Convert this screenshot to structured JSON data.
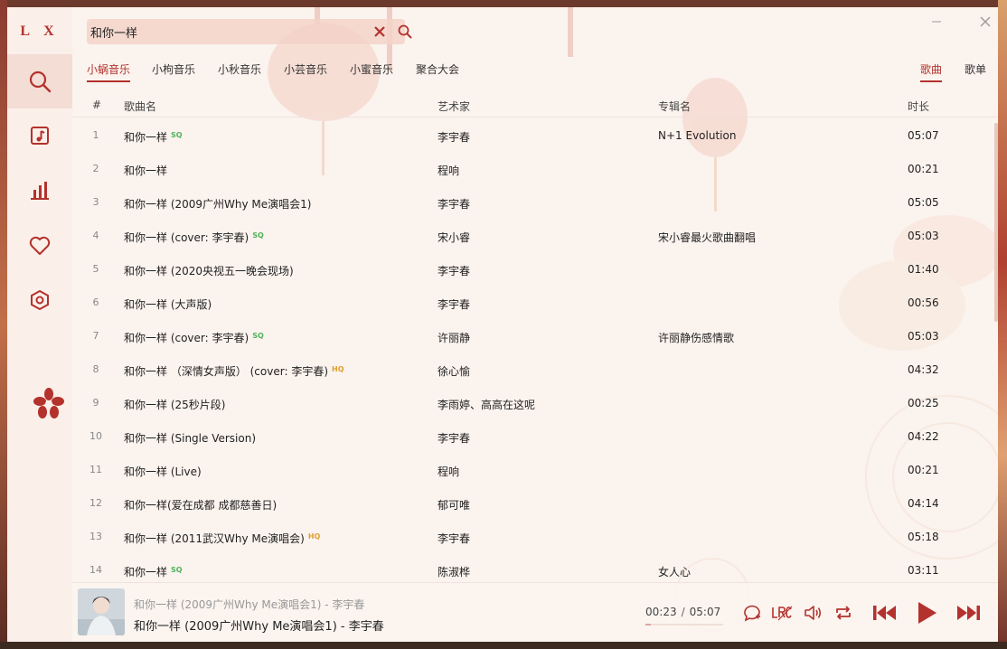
{
  "app": {
    "logo": "L X"
  },
  "search": {
    "value": "和你一样"
  },
  "source_tabs": [
    {
      "label": "小蜗音乐",
      "active": true
    },
    {
      "label": "小枸音乐",
      "active": false
    },
    {
      "label": "小秋音乐",
      "active": false
    },
    {
      "label": "小芸音乐",
      "active": false
    },
    {
      "label": "小蜜音乐",
      "active": false
    },
    {
      "label": "聚合大会",
      "active": false
    }
  ],
  "type_tabs": [
    {
      "label": "歌曲",
      "active": true
    },
    {
      "label": "歌单",
      "active": false
    }
  ],
  "table": {
    "headers": {
      "num": "#",
      "name": "歌曲名",
      "artist": "艺术家",
      "album": "专辑名",
      "duration": "时长"
    },
    "rows": [
      {
        "num": "1",
        "name": "和你一样",
        "quality": "SQ",
        "artist": "李宇春",
        "album": "N+1 Evolution",
        "duration": "05:07"
      },
      {
        "num": "2",
        "name": "和你一样",
        "quality": "",
        "artist": "程响",
        "album": "",
        "duration": "00:21"
      },
      {
        "num": "3",
        "name": "和你一样 (2009广州Why Me演唱会1)",
        "quality": "",
        "artist": "李宇春",
        "album": "",
        "duration": "05:05"
      },
      {
        "num": "4",
        "name": "和你一样 (cover: 李宇春)",
        "quality": "SQ",
        "artist": "宋小睿",
        "album": "宋小睿最火歌曲翻唱",
        "duration": "05:03"
      },
      {
        "num": "5",
        "name": "和你一样 (2020央视五一晚会现场)",
        "quality": "",
        "artist": "李宇春",
        "album": "",
        "duration": "01:40"
      },
      {
        "num": "6",
        "name": "和你一样 (大声版)",
        "quality": "",
        "artist": "李宇春",
        "album": "",
        "duration": "00:56"
      },
      {
        "num": "7",
        "name": "和你一样 (cover: 李宇春)",
        "quality": "SQ",
        "artist": "许丽静",
        "album": "许丽静伤感情歌",
        "duration": "05:03"
      },
      {
        "num": "8",
        "name": "和你一样 （深情女声版） (cover: 李宇春)",
        "quality": "HQ",
        "artist": "徐心愉",
        "album": "",
        "duration": "04:32"
      },
      {
        "num": "9",
        "name": "和你一样 (25秒片段)",
        "quality": "",
        "artist": "李雨婷、高高在这呢",
        "album": "",
        "duration": "00:25"
      },
      {
        "num": "10",
        "name": "和你一样 (Single Version)",
        "quality": "",
        "artist": "李宇春",
        "album": "",
        "duration": "04:22"
      },
      {
        "num": "11",
        "name": "和你一样 (Live)",
        "quality": "",
        "artist": "程响",
        "album": "",
        "duration": "00:21"
      },
      {
        "num": "12",
        "name": "和你一样(爱在成都 成都慈善日)",
        "quality": "",
        "artist": "郁可唯",
        "album": "",
        "duration": "04:14"
      },
      {
        "num": "13",
        "name": "和你一样 (2011武汉Why Me演唱会)",
        "quality": "HQ",
        "artist": "李宇春",
        "album": "",
        "duration": "05:18"
      },
      {
        "num": "14",
        "name": "和你一样",
        "quality": "SQ",
        "artist": "陈淑桦",
        "album": "女人心",
        "duration": "03:11"
      }
    ]
  },
  "player": {
    "title_small": "和你一样 (2009广州Why Me演唱会1) - 李宇春",
    "title": "和你一样 (2009广州Why Me演唱会1) - 李宇春",
    "current_time": "00:23",
    "separator": "/",
    "total_time": "05:07",
    "progress": 0.075
  },
  "colors": {
    "accent": "#b3322d",
    "sq": "#4fb35b",
    "hq": "#e0a030"
  },
  "icons": {
    "sidebar": [
      "search-icon",
      "music-list-icon",
      "chart-icon",
      "heart-icon",
      "settings-icon"
    ],
    "window": [
      "minimize-icon",
      "close-icon"
    ],
    "player": [
      "comment-icon",
      "lyrics-icon",
      "volume-icon",
      "repeat-icon",
      "prev-icon",
      "play-icon",
      "next-icon"
    ]
  }
}
